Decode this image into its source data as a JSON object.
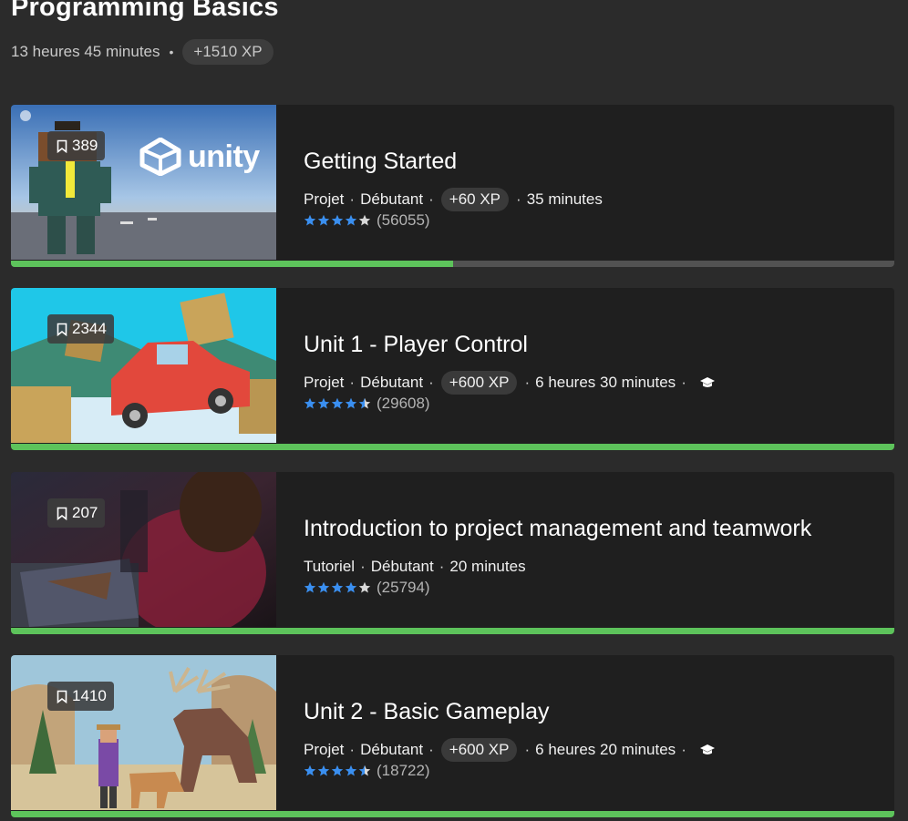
{
  "header": {
    "title": "Programming Basics",
    "duration": "13 heures 45 minutes",
    "separator": "•",
    "xp": "+1510 XP"
  },
  "colors": {
    "background": "#2b2b2b",
    "card": "#1f1f1f",
    "progress": "#5dc35b",
    "progress_track": "#525252",
    "star": "#3a8ff0"
  },
  "cards": [
    {
      "title": "Getting Started",
      "saves": "389",
      "type": "Projet",
      "level": "Débutant",
      "xp": "+60 XP",
      "duration": "35 minutes",
      "has_pathway_icon": false,
      "stars": 4,
      "rating_count": "(56055)",
      "progress": 0.5,
      "thumbnail": "unity-character",
      "logo_text": "unity"
    },
    {
      "title": "Unit 1 - Player Control",
      "saves": "2344",
      "type": "Projet",
      "level": "Débutant",
      "xp": "+600 XP",
      "duration": "6 heures 30 minutes",
      "has_pathway_icon": true,
      "stars": 4.5,
      "rating_count": "(29608)",
      "progress": 1.0,
      "thumbnail": "red-truck-crates"
    },
    {
      "title": "Introduction to project management and teamwork",
      "saves": "207",
      "type": "Tutoriel",
      "level": "Débutant",
      "xp": "",
      "duration": "20 minutes",
      "has_pathway_icon": false,
      "stars": 4,
      "rating_count": "(25794)",
      "progress": 1.0,
      "thumbnail": "person-laptop"
    },
    {
      "title": "Unit 2 - Basic Gameplay",
      "saves": "1410",
      "type": "Projet",
      "level": "Débutant",
      "xp": "+600 XP",
      "duration": "6 heures 20 minutes",
      "has_pathway_icon": true,
      "stars": 4.5,
      "rating_count": "(18722)",
      "progress": 1.0,
      "thumbnail": "moose-farmer"
    }
  ]
}
